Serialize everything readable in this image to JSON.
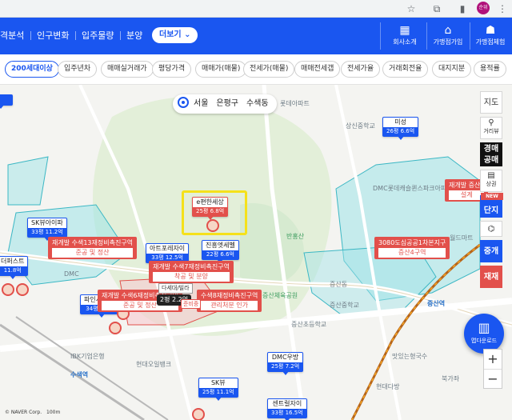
{
  "browser": {
    "icons": [
      "star-icon",
      "extensions-icon",
      "sidebar-icon",
      "profile-avatar",
      "menu-icon"
    ],
    "profile_text": "순위"
  },
  "appbar": {
    "nav": [
      "격분석",
      "인구변화",
      "입주물량",
      "분양"
    ],
    "more_label": "더보기",
    "right": [
      {
        "label": "회사소개",
        "icon": "company-icon"
      },
      {
        "label": "가맹점가입",
        "icon": "store-icon"
      },
      {
        "label": "가맹점체험",
        "icon": "team-icon"
      }
    ],
    "accent": "#1a56f0"
  },
  "filters": [
    "200세대이상",
    "입주년차",
    "매매실거래가",
    "평당가격",
    "매매가(매물)",
    "전세가(매물)",
    "매매전세갭",
    "전세가율",
    "거래회전율",
    "대지지분",
    "용적률"
  ],
  "breadcrumb": {
    "parts": [
      "서울",
      "은평구",
      "수색동"
    ]
  },
  "apartments": [
    {
      "key": "mi",
      "name": "미성",
      "price": "26평 6.6억",
      "color": "blue"
    },
    {
      "key": "eph",
      "name": "e편한세상",
      "price": "25평 6.8억",
      "color": "red"
    },
    {
      "key": "skv",
      "name": "SK뷰아이파",
      "price": "33평 11.2억",
      "color": "blue"
    },
    {
      "key": "art",
      "name": "아트포레자이",
      "price": "33평 12.5억",
      "color": "blue"
    },
    {
      "key": "jin",
      "name": "진흥엣세벨",
      "price": "22평 6.6억",
      "color": "blue"
    },
    {
      "key": "dup",
      "name": "더퍼스트",
      "price": "11.8억",
      "color": "blue"
    },
    {
      "key": "pin",
      "name": "파인시티자이",
      "price": "34평 12.8억",
      "color": "blue"
    },
    {
      "key": "dmc",
      "name": "DMC우방",
      "price": "25평 7.2억",
      "color": "blue"
    },
    {
      "key": "sk2",
      "name": "SK뷰",
      "price": "25평 11.1억",
      "color": "blue"
    },
    {
      "key": "cen",
      "name": "센트럴자이",
      "price": "33평 16.5억",
      "color": "blue"
    }
  ],
  "redevelopment": [
    {
      "key": "r1",
      "title": "재개발 수색13재정비촉진구역",
      "status": "준공 및 정산"
    },
    {
      "key": "r2",
      "title": "재개발 수색7재정비촉진구역",
      "status": "착공 및 분양"
    },
    {
      "key": "r3",
      "title": "3080도심공공1차본지구",
      "status": "증산4구역"
    },
    {
      "key": "r4",
      "title": "재개발 증산5",
      "status": "설계"
    },
    {
      "key": "r5",
      "title": "재개발 수색6재정비촉진구역",
      "status": "준공 및 정산"
    },
    {
      "key": "r6",
      "title": "수색8재정비촉진구역",
      "status": "관리처분 인가"
    }
  ],
  "villa": {
    "label": "다세대/빌라",
    "pill": "2평 2.2억",
    "tag": "준비중"
  },
  "places": [
    {
      "key": "p1",
      "text": "롯데아파트",
      "cls": ""
    },
    {
      "key": "p2",
      "text": "상신중학교",
      "cls": ""
    },
    {
      "key": "p3",
      "text": "DMC롯데캐슬퀸스파크아파트",
      "cls": ""
    },
    {
      "key": "p4",
      "text": "반홍산",
      "cls": "g"
    },
    {
      "key": "p5",
      "text": "증산체육공원",
      "cls": "g"
    },
    {
      "key": "p6",
      "text": "증산중학교",
      "cls": ""
    },
    {
      "key": "p7",
      "text": "증산초등학교",
      "cls": ""
    },
    {
      "key": "p8",
      "text": "증산동",
      "cls": ""
    },
    {
      "key": "p9",
      "text": "증산역",
      "cls": "b"
    },
    {
      "key": "p10",
      "text": "수색역",
      "cls": "b"
    },
    {
      "key": "p11",
      "text": "IBK기업은행",
      "cls": ""
    },
    {
      "key": "p12",
      "text": "DMC",
      "cls": ""
    },
    {
      "key": "p13",
      "text": "현대오일뱅크",
      "cls": ""
    },
    {
      "key": "p14",
      "text": "맛있는형국수",
      "cls": ""
    },
    {
      "key": "p15",
      "text": "북가좌",
      "cls": ""
    },
    {
      "key": "p16",
      "text": "현대다방",
      "cls": ""
    },
    {
      "key": "p17",
      "text": "월드마트",
      "cls": ""
    }
  ],
  "tools": {
    "map_type": "지도",
    "street_view": "거리뷰",
    "auction": "경매공매",
    "new_badge": "NEW",
    "complex": "단지",
    "commercial": "상권",
    "brokerage": "중개",
    "redevelop": "재재"
  },
  "fab_label": "맵다운로드",
  "zoom": {
    "in": "+",
    "out": "−"
  },
  "footer": {
    "naver": "© NAVER Corp.",
    "scale": "100m"
  }
}
